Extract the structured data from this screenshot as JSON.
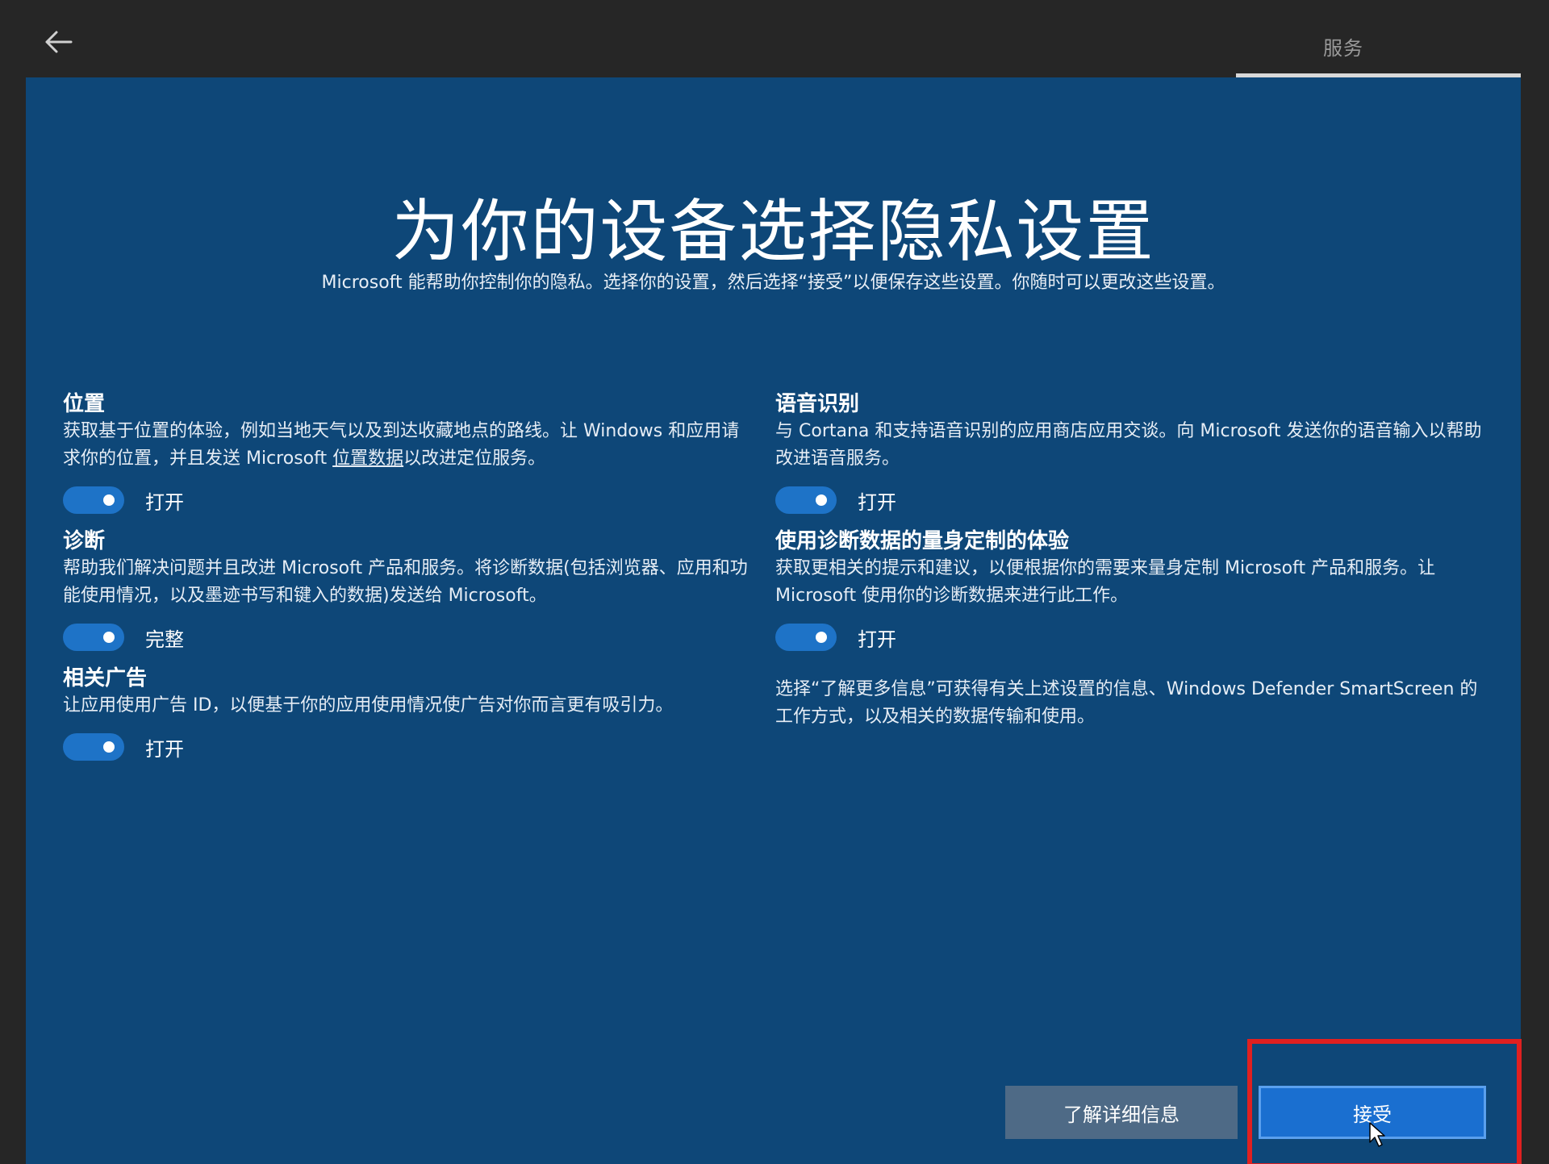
{
  "header": {
    "back_icon": "back-arrow-icon",
    "step_label": "服务"
  },
  "main": {
    "title": "为你的设备选择隐私设置",
    "subtitle": "Microsoft 能帮助你控制你的隐私。选择你的设置，然后选择“接受”以便保存这些设置。你随时可以更改这些设置。"
  },
  "settings_left": [
    {
      "title": "位置",
      "desc_part1": "获取基于位置的体验，例如当地天气以及到达收藏地点的路线。让 Windows 和应用请求你的位置，并且发送 Microsoft ",
      "desc_link": "位置数据",
      "desc_part2": "以改进定位服务。",
      "toggle_state": "打开",
      "enabled": true
    },
    {
      "title": "诊断",
      "desc": "帮助我们解决问题并且改进 Microsoft 产品和服务。将诊断数据(包括浏览器、应用和功能使用情况，以及墨迹书写和键入的数据)发送给 Microsoft。",
      "toggle_state": "完整",
      "enabled": true
    },
    {
      "title": "相关广告",
      "desc": "让应用使用广告 ID，以便基于你的应用使用情况使广告对你而言更有吸引力。",
      "toggle_state": "打开",
      "enabled": true
    }
  ],
  "settings_right": [
    {
      "title": "语音识别",
      "desc": "与 Cortana 和支持语音识别的应用商店应用交谈。向 Microsoft 发送你的语音输入以帮助改进语音服务。",
      "toggle_state": "打开",
      "enabled": true
    },
    {
      "title": "使用诊断数据的量身定制的体验",
      "desc": "获取更相关的提示和建议，以便根据你的需要来量身定制 Microsoft 产品和服务。让 Microsoft 使用你的诊断数据来进行此工作。",
      "toggle_state": "打开",
      "enabled": true
    }
  ],
  "info_text": "选择“了解更多信息”可获得有关上述设置的信息、Windows Defender SmartScreen 的工作方式，以及相关的数据传输和使用。",
  "buttons": {
    "learn_more": "了解详细信息",
    "accept": "接受"
  },
  "colors": {
    "panel_bg": "#0e4778",
    "toggle_on": "#1e73c7",
    "accept_button": "#1a6fd0",
    "learn_button": "#4e6a86",
    "highlight": "#e02020"
  }
}
